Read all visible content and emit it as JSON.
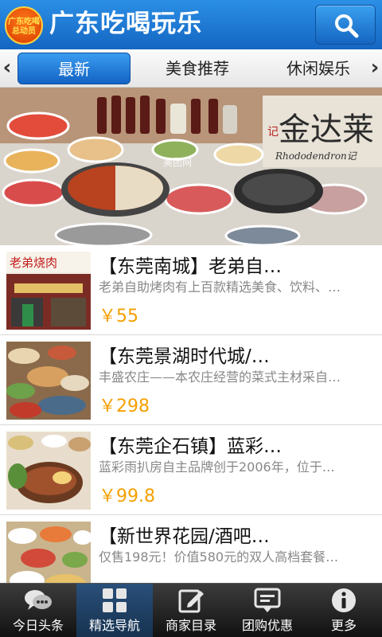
{
  "header": {
    "logo_text": "广东吃喝\n总动员",
    "title": "广东吃喝玩乐",
    "search_icon": "search-icon"
  },
  "tabs": {
    "items": [
      {
        "label": "最新",
        "active": true
      },
      {
        "label": "美食推荐",
        "active": false
      },
      {
        "label": "休闲娱乐",
        "active": false
      }
    ]
  },
  "banner": {
    "sign_text": "金达莱",
    "sign_small": "记",
    "sign_en": "Rhododendron记",
    "watermark": "美团网"
  },
  "list": [
    {
      "title": "【东莞南城】老弟自…",
      "desc": "老弟自助烤肉有上百款精选美食、饮料、…",
      "price": "￥55",
      "thumb_sign": "老弟烧肉"
    },
    {
      "title": "【东莞景湖时代城/…",
      "desc": "丰盛农庄——本农庄经营的菜式主材采自…",
      "price": "￥298"
    },
    {
      "title": "【东莞企石镇】蓝彩…",
      "desc": "蓝彩雨扒房自主品牌创于2006年，位于…",
      "price": "￥99.8"
    },
    {
      "title": "【新世界花园/酒吧…",
      "desc": "仅售198元！价值580元的双人高档套餐…",
      "price": ""
    }
  ],
  "nav": {
    "items": [
      {
        "label": "今日头条",
        "icon": "chat-bubbles-icon",
        "active": false
      },
      {
        "label": "精选导航",
        "icon": "grid-icon",
        "active": true
      },
      {
        "label": "商家目录",
        "icon": "edit-icon",
        "active": false
      },
      {
        "label": "团购优惠",
        "icon": "message-icon",
        "active": false
      },
      {
        "label": "更多",
        "icon": "info-icon",
        "active": false
      }
    ]
  },
  "colors": {
    "header_blue": "#1466c2",
    "price_orange": "#f5a000",
    "nav_dark": "#111111"
  }
}
